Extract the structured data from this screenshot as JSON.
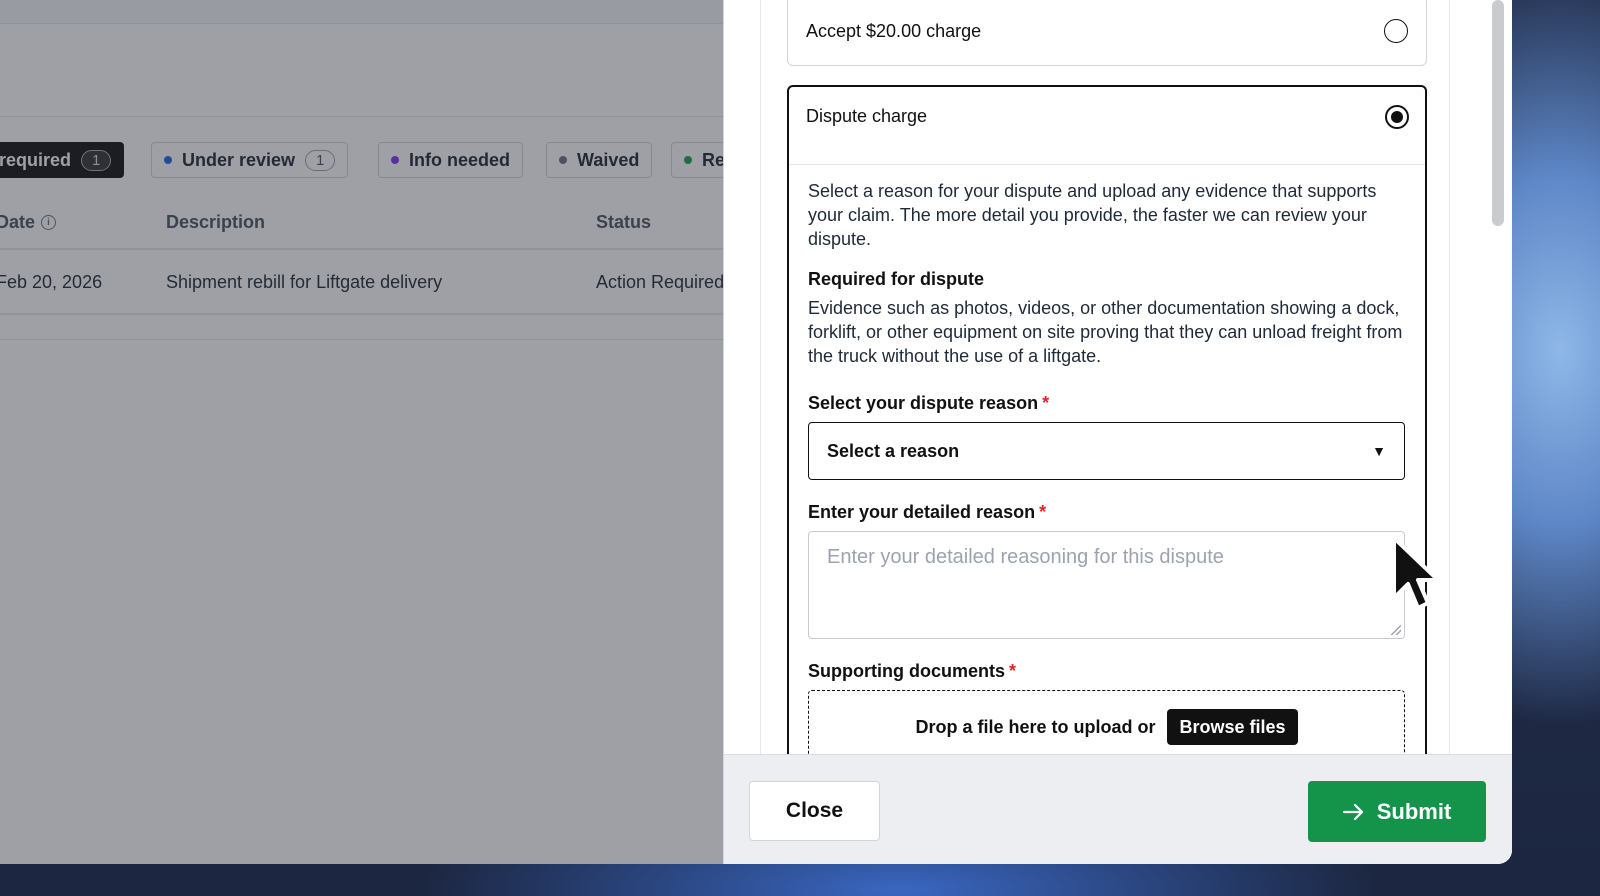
{
  "filters": [
    {
      "label": "required",
      "count": "1",
      "active": true,
      "dot_color": ""
    },
    {
      "label": "Under review",
      "count": "1",
      "active": false,
      "dot_color": "#2563eb"
    },
    {
      "label": "Info needed",
      "count": "",
      "active": false,
      "dot_color": "#7c3aed"
    },
    {
      "label": "Waived",
      "count": "",
      "active": false,
      "dot_color": "#6b7280"
    },
    {
      "label": "Re",
      "count": "",
      "active": false,
      "dot_color": "#16a34a"
    }
  ],
  "table": {
    "columns": [
      "Date",
      "Description",
      "Status"
    ],
    "rows": [
      {
        "date": "Feb 20, 2026",
        "description": "Shipment rebill for Liftgate delivery",
        "status": "Action Required"
      }
    ]
  },
  "drawer": {
    "accept_option": "Accept $20.00 charge",
    "dispute_option": "Dispute charge",
    "dispute_intro": "Select a reason for your dispute and upload any evidence that supports your claim. The more detail you provide, the faster we can review your dispute.",
    "required_heading": "Required for dispute",
    "required_text": "Evidence such as photos, videos, or other documentation showing a dock, forklift, or other equipment on site proving that they can unload freight from the truck without the use of a liftgate.",
    "reason_label": "Select your dispute reason",
    "reason_value": "Select a reason",
    "detail_label": "Enter your detailed reason",
    "detail_placeholder": "Enter your detailed reasoning for this dispute",
    "docs_label": "Supporting documents",
    "drop_text": "Drop a file here to upload or",
    "browse_label": "Browse files",
    "required_mark": "*"
  },
  "footer": {
    "close_label": "Close",
    "submit_label": "Submit"
  },
  "colors": {
    "submit": "#13944a",
    "required": "#dc2626"
  }
}
